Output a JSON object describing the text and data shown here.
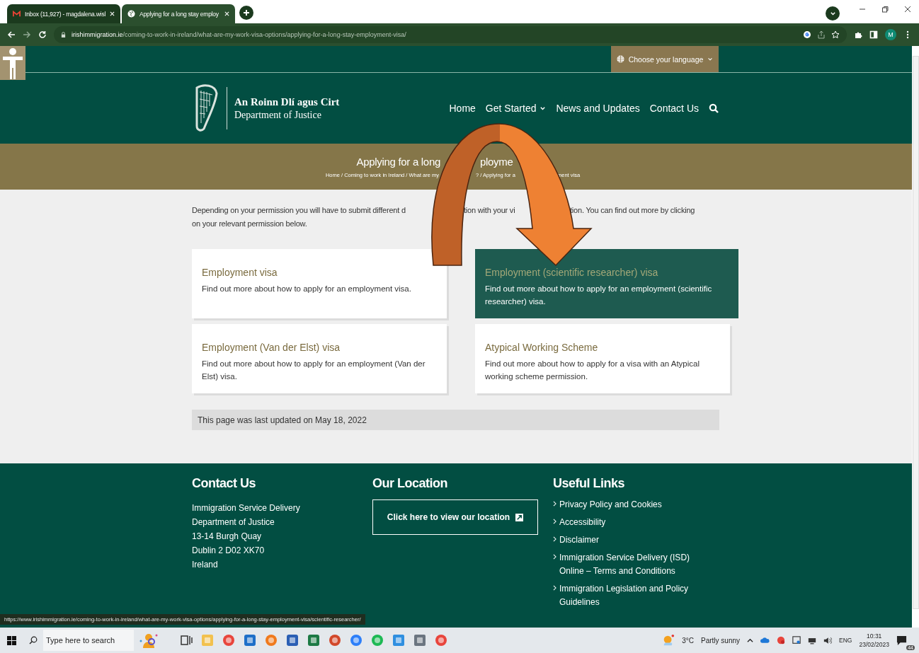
{
  "browser": {
    "tabs": [
      {
        "title": "Inbox (11,927) - magdalena.wisl",
        "selected": false,
        "kind": "mail"
      },
      {
        "title": "Applying for a long stay employ",
        "selected": true,
        "kind": "globe"
      }
    ],
    "url_domain": "irishimmigration.ie",
    "url_path": "/coming-to-work-in-ireland/what-are-my-work-visa-options/applying-for-a-long-stay-employment-visa/",
    "avatar": "M",
    "status_url": "https://www.irishimmigration.ie/coming-to-work-in-ireland/what-are-my-work-visa-options/applying-for-a-long-stay-employment-visa/scientific-researcher/"
  },
  "site": {
    "language_button": "Choose your language",
    "logo_irish": "An Roinn Dlí agus Cirt",
    "logo_english": "Department of Justice",
    "nav": [
      {
        "label": "Home",
        "dropdown": false
      },
      {
        "label": "Get Started",
        "dropdown": true
      },
      {
        "label": "News and Updates",
        "dropdown": false
      },
      {
        "label": "Contact Us",
        "dropdown": false
      }
    ],
    "title_fragments": [
      "Applying for a long",
      "ployme"
    ],
    "breadcrumb_fragments": [
      "Home / Coming to work in Ireland / What are my",
      "? / Applying for a",
      "ment visa"
    ],
    "intro_line_fragments": [
      "Depending on your permission you will have to submit different d",
      "tion with your vi",
      "tion. You can find out more by clicking"
    ],
    "intro_line_2": "on your relevant permission below.",
    "cards": [
      {
        "title": "Employment visa",
        "text": "Find out more about how to apply for an employment visa.",
        "selected": false
      },
      {
        "title": "Employment (scientific researcher) visa",
        "text": "Find out more about how to apply for an employment (scientific researcher) visa.",
        "selected": true
      },
      {
        "title": "Employment (Van der Elst) visa",
        "text": "Find out more about how to apply for an employment (Van der Elst) visa.",
        "selected": false
      },
      {
        "title": "Atypical Working Scheme",
        "text": "Find out more about how to apply for a visa with an Atypical working scheme permission.",
        "selected": false
      }
    ],
    "last_updated": "This page was last updated on May 18, 2022",
    "footer": {
      "contact_heading": "Contact Us",
      "contact_lines": [
        "Immigration Service Delivery",
        "Department of Justice",
        "13-14 Burgh Quay",
        "Dublin 2 D02 XK70",
        "Ireland"
      ],
      "location_heading": "Our Location",
      "location_button": "Click here to view our location",
      "links_heading": "Useful Links",
      "links": [
        "Privacy Policy and Cookies",
        "Accessibility",
        "Disclaimer",
        "Immigration Service Delivery (ISD) Online – Terms and Conditions",
        "Immigration Legislation and Policy Guidelines"
      ]
    }
  },
  "taskbar": {
    "search_placeholder": "Type here to search",
    "temperature": "3°C",
    "weather": "Partly sunny",
    "language": "ENG",
    "time": "10:31",
    "date": "23/02/2023",
    "notifications": "44"
  }
}
